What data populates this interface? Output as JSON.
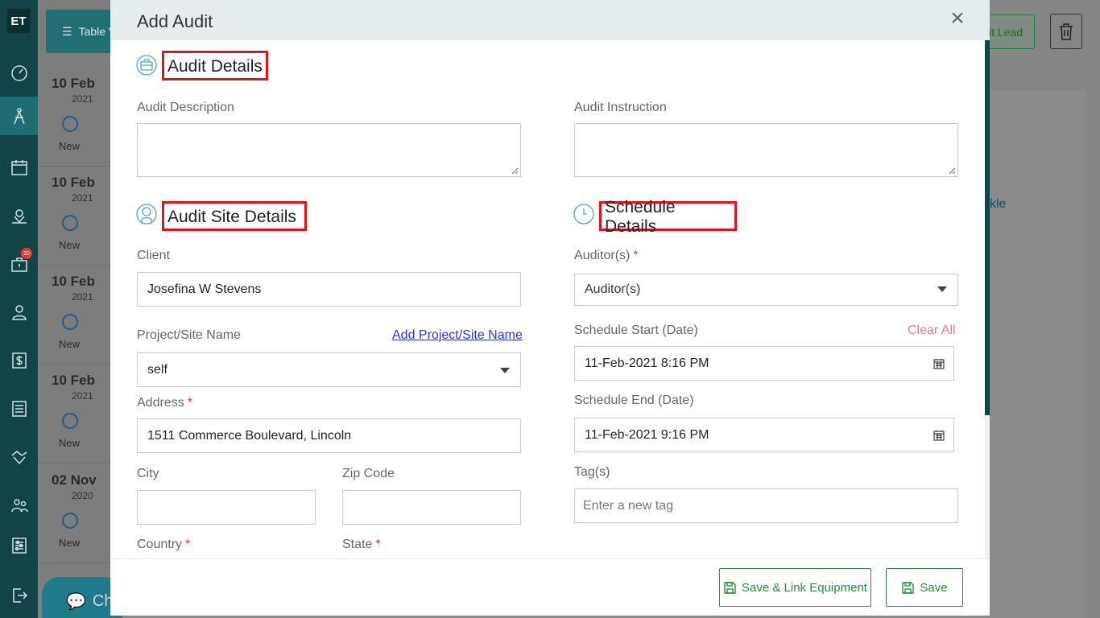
{
  "rail": {
    "logo": "ET",
    "badge": "20"
  },
  "background": {
    "table_button": "Table V",
    "rows": [
      {
        "day": "10 Feb",
        "year": "2021",
        "status": "New"
      },
      {
        "day": "10 Feb",
        "year": "2021",
        "status": "New"
      },
      {
        "day": "10 Feb",
        "year": "2021",
        "status": "New"
      },
      {
        "day": "10 Feb",
        "year": "2021",
        "status": "New"
      },
      {
        "day": "02 Nov",
        "year": "2020",
        "status": "New"
      }
    ],
    "lead_button": "lit Lead",
    "partial_text": "kle",
    "chat_label": "Ch"
  },
  "modal": {
    "title": "Add Audit",
    "audit_details": {
      "title": "Audit Details",
      "description_label": "Audit Description",
      "description_value": "",
      "instruction_label": "Audit Instruction",
      "instruction_value": ""
    },
    "site_details": {
      "title": "Audit Site Details",
      "client_label": "Client",
      "client_value": "Josefina W Stevens",
      "project_label": "Project/Site Name",
      "project_link": "Add Project/Site Name",
      "project_value": "self",
      "address_label": "Address",
      "address_value": "1511  Commerce Boulevard, Lincoln",
      "city_label": "City",
      "zip_label": "Zip Code",
      "country_label": "Country",
      "state_label": "State",
      "required_mark": "*"
    },
    "schedule": {
      "title": "Schedule Details",
      "auditors_label": "Auditor(s)",
      "auditors_value": "Auditor(s)",
      "start_label": "Schedule Start (Date)",
      "clear_all": "Clear All",
      "start_value": "11-Feb-2021 8:16 PM",
      "end_label": "Schedule End (Date)",
      "end_value": "11-Feb-2021 9:16 PM",
      "tags_label": "Tag(s)",
      "tags_placeholder": "Enter a new tag"
    },
    "footer": {
      "save_link_label": "Save & Link Equipment",
      "save_label": "Save"
    }
  }
}
